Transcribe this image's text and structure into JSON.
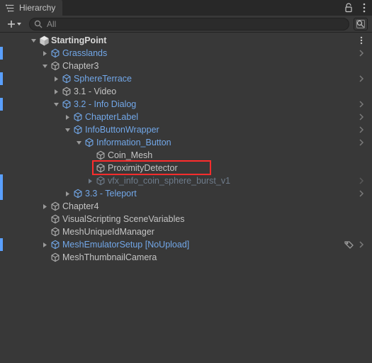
{
  "panel": {
    "tab_title": "Hierarchy",
    "search_placeholder": "All"
  },
  "tree": {
    "root": {
      "label": "StartingPoint",
      "children": [
        {
          "id": "grasslands",
          "label": "Grasslands"
        },
        {
          "id": "chapter3",
          "label": "Chapter3",
          "children": [
            {
              "id": "sphereterrace",
              "label": "SphereTerrace"
            },
            {
              "id": "video",
              "label": "3.1 - Video"
            },
            {
              "id": "infodialog",
              "label": "3.2 - Info Dialog",
              "children": [
                {
                  "id": "chapterlabel",
                  "label": "ChapterLabel"
                },
                {
                  "id": "infobuttonwrapper",
                  "label": "InfoButtonWrapper",
                  "children": [
                    {
                      "id": "informationbutton",
                      "label": "Information_Button",
                      "children": [
                        {
                          "id": "coinmesh",
                          "label": "Coin_Mesh"
                        },
                        {
                          "id": "proximitydetector",
                          "label": "ProximityDetector"
                        },
                        {
                          "id": "vfx",
                          "label": "vfx_info_coin_sphere_burst_v1"
                        }
                      ]
                    }
                  ]
                },
                {
                  "id": "teleport",
                  "label": "3.3 - Teleport"
                }
              ]
            }
          ]
        },
        {
          "id": "chapter4",
          "label": "Chapter4"
        },
        {
          "id": "vsv",
          "label": "VisualScripting SceneVariables"
        },
        {
          "id": "muid",
          "label": "MeshUniqueIdManager"
        },
        {
          "id": "emu",
          "label": "MeshEmulatorSetup [NoUpload]"
        },
        {
          "id": "thumb",
          "label": "MeshThumbnailCamera"
        }
      ]
    }
  }
}
